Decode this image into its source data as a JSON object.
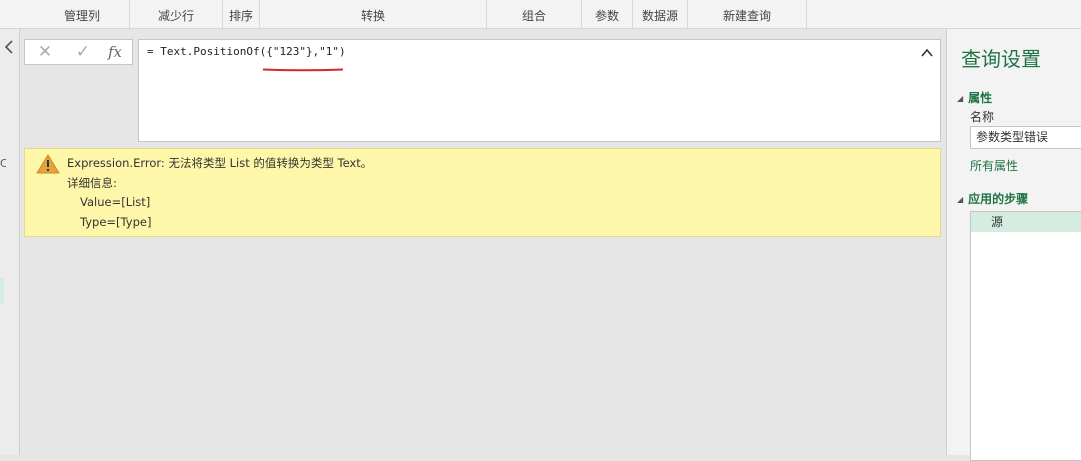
{
  "ribbon": {
    "groups": [
      "管理列",
      "减少行",
      "排序",
      "转换",
      "组合",
      "参数",
      "数据源",
      "新建查询"
    ]
  },
  "left_pane": {
    "stub_text": "C"
  },
  "formula_bar": {
    "cancel_glyph": "✕",
    "commit_glyph": "✓",
    "fx_label": "fx",
    "formula": "= Text.PositionOf({\"123\"},\"1\")"
  },
  "error": {
    "line1": "Expression.Error: 无法将类型 List 的值转换为类型 Text。",
    "line2": "详细信息:",
    "line3": "Value=[List]",
    "line4": "Type=[Type]"
  },
  "query_settings": {
    "title": "查询设置",
    "properties_header": "属性",
    "name_label": "名称",
    "name_value": "参数类型错误",
    "all_properties_link": "所有属性",
    "applied_steps_header": "应用的步骤",
    "steps": [
      "源"
    ]
  },
  "colors": {
    "accent": "#217346",
    "error_bg": "#fef7aa",
    "underline": "#d9252a",
    "step_selected": "#d4ede0"
  }
}
